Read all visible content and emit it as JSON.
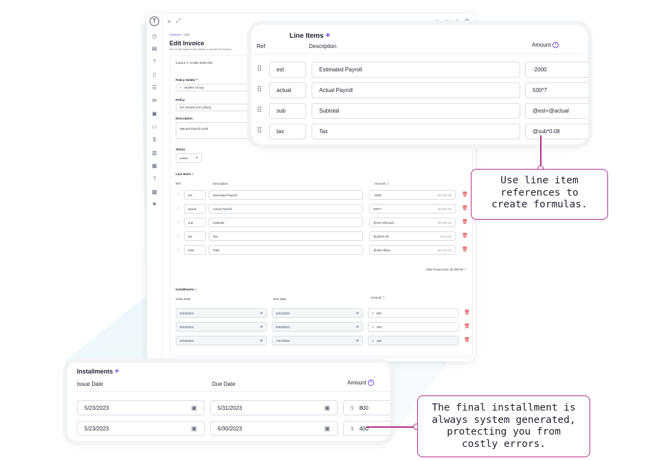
{
  "colors": {
    "accent": "#6d3ee0",
    "delete": "#dc2626",
    "callout_border": "#b02a8a"
  },
  "header": {
    "breadcrumb_root": "Invoices",
    "breadcrumb_sep": ">",
    "breadcrumb_current": "Edit",
    "title": "Edit Invoice",
    "subtitle": "Fill out all required form fields to update the invoice"
  },
  "form": {
    "invoice_number": "Invoice #: ACME-0036-000",
    "policy_holder_label": "Policy Holder *",
    "policy_holder_value": "Mueller Group",
    "policy_label": "Policy",
    "policy_value": "EX-202302-037 (2023)",
    "description_label": "Description",
    "description_value": "Manual Payroll Audit",
    "status_label": "Status",
    "status_value": "active"
  },
  "line_items": {
    "title": "Line Items",
    "add": "+",
    "headers": {
      "ref": "Ref",
      "description": "Description",
      "amount": "Amount"
    },
    "rows": [
      {
        "ref": "est",
        "description": "Estimated Payroll",
        "formula": "-2000",
        "computed": "-$2,000.00"
      },
      {
        "ref": "actual",
        "description": "Actual Payroll",
        "formula": "500*7",
        "computed": "$3,500.00"
      },
      {
        "ref": "sub",
        "description": "Subtotal",
        "formula": "@est+@actual",
        "computed": "$1,500.00"
      },
      {
        "ref": "tax",
        "description": "Tax",
        "formula": "@sub*0.08",
        "computed": "$120.00"
      },
      {
        "ref": "total",
        "description": "Total",
        "formula": "@sub+@tax",
        "computed": "$1,620.00"
      }
    ],
    "total_due": "Total Amount Due: $1,620.00"
  },
  "installments": {
    "title": "Installments",
    "add": "+",
    "headers": {
      "issue": "Issue Date",
      "due": "Due Date",
      "amount": "Amount"
    },
    "currency": "$",
    "rows": [
      {
        "issue": "5/23/2023",
        "due": "5/31/2023",
        "amount": "800"
      },
      {
        "issue": "5/23/2023",
        "due": "6/30/2023",
        "amount": "400"
      },
      {
        "issue": "5/23/2023",
        "due": "7/31/2023",
        "amount": "420"
      }
    ]
  },
  "callouts": {
    "formulas": [
      "Use line item",
      "references to",
      "create formulas."
    ],
    "installment": [
      "The final installment is",
      "always system generated,",
      "protecting you from",
      "costly errors."
    ]
  },
  "icons": [
    "logo-icon",
    "menu-icon",
    "expand-icon",
    "search-icon",
    "mail-icon",
    "bell-icon",
    "help-icon",
    "info-icon",
    "drag-handle-icon",
    "trash-icon",
    "calendar-icon"
  ]
}
